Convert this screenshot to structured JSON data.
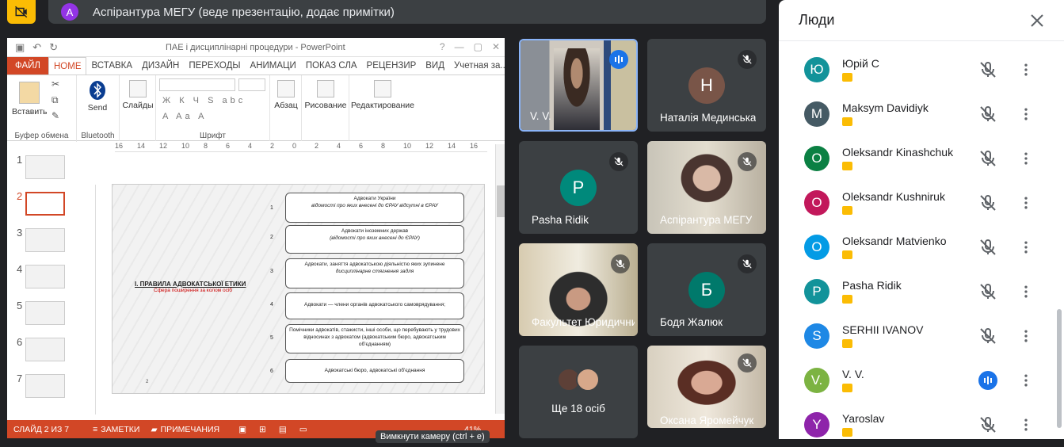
{
  "presenter": {
    "avatar_letter": "A",
    "text": "Аспірантура МЕГУ (веде презентацію, додає примітки)"
  },
  "ppt": {
    "window_title": "ПАЕ і дисциплінарні процедури - PowerPoint",
    "tabs": [
      "ФАЙЛ",
      "HOME",
      "ВСТАВКА",
      "ДИЗАЙН",
      "ПЕРЕХОДЫ",
      "АНИМАЦИ",
      "ПОКАЗ СЛА",
      "РЕЦЕНЗИР",
      "ВИД"
    ],
    "account": "Учетная за...",
    "ribbon": {
      "paste": "Вставить",
      "clipboard": "Буфер обмена",
      "send": "Send",
      "bluetooth": "Bluetooth",
      "slides": "Слайды",
      "font": "Шрифт",
      "paragraph": "Абзац",
      "drawing": "Рисование",
      "editing": "Редактирование"
    },
    "ruler_top": [
      "16",
      "14",
      "12",
      "10",
      "8",
      "6",
      "4",
      "2",
      "0",
      "2",
      "4",
      "6",
      "8",
      "10",
      "12",
      "14",
      "16"
    ],
    "slide_numbers": [
      "1",
      "2",
      "3",
      "4",
      "5",
      "6",
      "7"
    ],
    "slide": {
      "title": "І. ПРАВИЛА АДВОКАТСЬКОЇ ЕТИКИ",
      "subtitle": "Сфера поширення за колом осіб",
      "page": "2",
      "items": [
        {
          "n": "1",
          "text": "Адвокати України",
          "sub": "відомості про яких внесені до ЄРАУ відсутні в ЄРАУ"
        },
        {
          "n": "2",
          "text": "Адвокати іноземних держав",
          "sub": "(відомості про яких внесені до ЄРАУ)"
        },
        {
          "n": "3",
          "text": "Адвокати, заняття адвокатською діяльністю яких зупинене",
          "sub": "дисциплінарне стягнення задля"
        },
        {
          "n": "4",
          "text": "Адвокати — члени органів адвокатського самоврядування;",
          "sub": ""
        },
        {
          "n": "5",
          "text": "Помічники адвокатів, стажисти, інші особи, що перебувають у трудових відносинах з адвокатом (адвокатським бюро, адвокатським об'єднанням)",
          "sub": ""
        },
        {
          "n": "6",
          "text": "Адвокатські бюро, адвокатські об'єднання",
          "sub": ""
        }
      ]
    },
    "status": {
      "slide_of": "СЛАЙД 2 ИЗ 7",
      "notes": "ЗАМЕТКИ",
      "comments": "ПРИМЕЧАНИЯ",
      "zoom": "41%"
    }
  },
  "tiles": [
    {
      "name": "V. V.",
      "type": "video",
      "speaking": true
    },
    {
      "name": "Наталія Мединська",
      "letter": "Н",
      "color": "#795548",
      "muted": true
    },
    {
      "name": "Pasha Ridik",
      "letter": "P",
      "color": "#00897b",
      "muted": true
    },
    {
      "name": "Аспірантура МЕГУ",
      "type": "video",
      "muted": true
    },
    {
      "name": "Факультет Юридичний",
      "type": "video",
      "muted": true
    },
    {
      "name": "Бодя Жалюк",
      "letter": "Б",
      "color": "#00796b",
      "muted": true
    },
    {
      "name": "Ще 18 осіб",
      "type": "more"
    },
    {
      "name": "Оксана Яромейчук",
      "type": "video",
      "muted": true
    }
  ],
  "tooltip": "Вимкнути камеру (ctrl + e)",
  "people": {
    "title": "Люди",
    "list": [
      {
        "letter": "Ю",
        "name": "Юрій С",
        "color": "#12939a",
        "speaking": false
      },
      {
        "letter": "M",
        "name": "Maksym Davidiyk",
        "color": "#455a64",
        "speaking": false
      },
      {
        "letter": "O",
        "name": "Oleksandr Kinashchuk",
        "color": "#0b8043",
        "speaking": false
      },
      {
        "letter": "O",
        "name": "Oleksandr Kushniruk",
        "color": "#c2185b",
        "speaking": false
      },
      {
        "letter": "O",
        "name": "Oleksandr Matvienko",
        "color": "#039be5",
        "speaking": false
      },
      {
        "letter": "P",
        "name": "Pasha Ridik",
        "color": "#12939a",
        "speaking": false
      },
      {
        "letter": "S",
        "name": "SERHII IVANOV",
        "color": "#1e88e5",
        "speaking": false
      },
      {
        "letter": "V.",
        "name": "V. V.",
        "color": "#7cb342",
        "speaking": true
      },
      {
        "letter": "Y",
        "name": "Yaroslav",
        "color": "#8e24aa",
        "speaking": false
      }
    ]
  }
}
